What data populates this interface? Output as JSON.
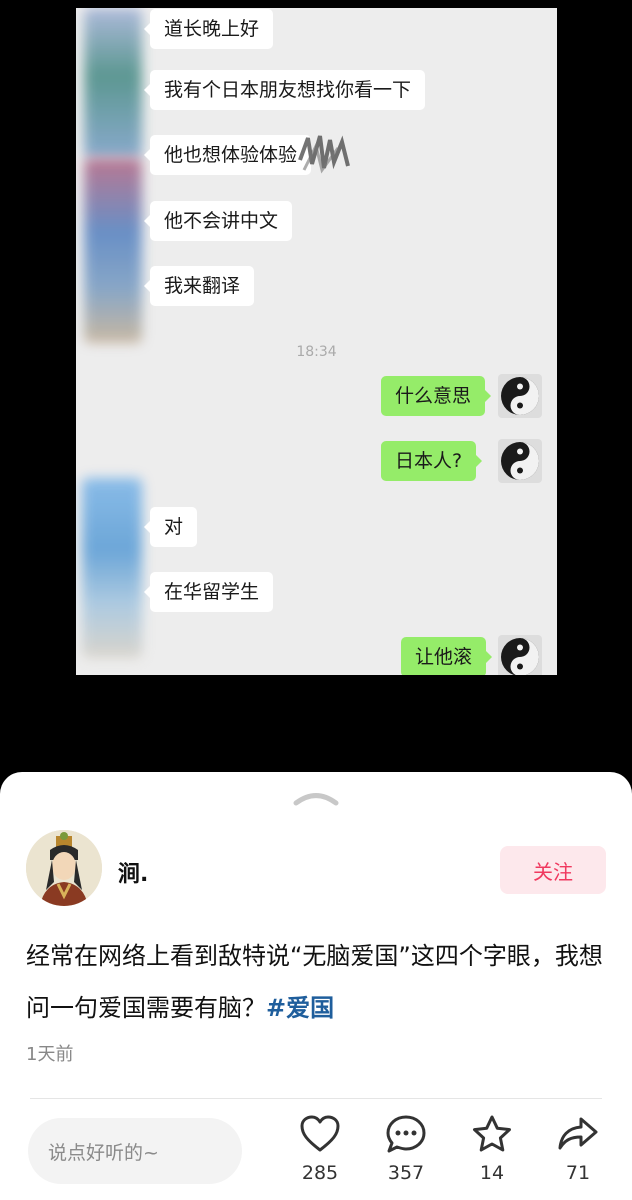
{
  "chat": {
    "messages": [
      {
        "text": "道长晚上好"
      },
      {
        "text": "我有个日本朋友想找你看一下"
      },
      {
        "text": "他也想体验体验"
      },
      {
        "text": "他不会讲中文"
      },
      {
        "text": "我来翻译"
      },
      {
        "text": "什么意思"
      },
      {
        "text": "日本人?"
      },
      {
        "text": "对"
      },
      {
        "text": "在华留学生"
      },
      {
        "text": "让他滚"
      }
    ],
    "timestamp": "18:34"
  },
  "post": {
    "author": "涧.",
    "follow_label": "关注",
    "text": "经常在网络上看到敌特说“无脑爱国”这四个字眼，我想问一句爱国需要有脑？",
    "hashtag": "#爱国",
    "time": "1天前"
  },
  "footer": {
    "comment_placeholder": "说点好听的~",
    "likes": "285",
    "comments": "357",
    "favorites": "14",
    "shares": "71"
  },
  "colors": {
    "my_bubble": "#95ec69",
    "follow_text": "#f0395f",
    "follow_bg": "#fde8ec",
    "hashtag": "#1f5e9c"
  }
}
